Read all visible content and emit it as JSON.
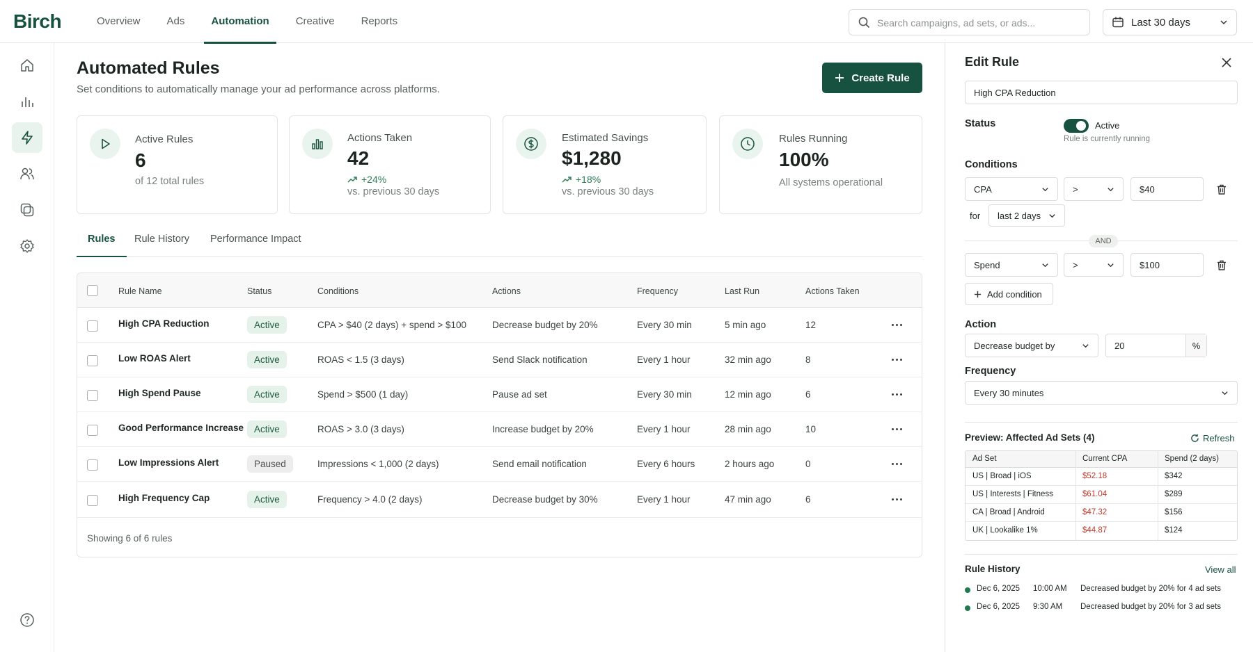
{
  "app": {
    "logo": "Birch"
  },
  "nav": [
    {
      "label": "Overview"
    },
    {
      "label": "Ads"
    },
    {
      "label": "Automation"
    },
    {
      "label": "Creative"
    },
    {
      "label": "Reports"
    }
  ],
  "search": {
    "placeholder": "Search campaigns, ad sets, or ads..."
  },
  "date_range": {
    "label": "Last 30 days"
  },
  "sidebar": {
    "icons": [
      "home-icon",
      "chart-icon",
      "bolt-icon",
      "users-icon",
      "layers-icon",
      "gear-icon",
      "help-icon"
    ]
  },
  "page": {
    "title": "Automated Rules",
    "subtitle": "Set conditions to automatically manage your ad performance across platforms.",
    "create_label": "Create Rule"
  },
  "kpis": [
    {
      "label": "Active Rules",
      "value": "6",
      "delta": "",
      "sub": "of 12 total rules"
    },
    {
      "label": "Actions Taken",
      "value": "42",
      "delta": "+24%",
      "sub": "vs. previous 30 days"
    },
    {
      "label": "Estimated Savings",
      "value": "$1,280",
      "delta": "+18%",
      "sub": "vs. previous 30 days"
    },
    {
      "label": "Rules Running",
      "value": "100%",
      "delta": "",
      "sub": "All systems operational"
    }
  ],
  "tabs": [
    {
      "label": "Rules"
    },
    {
      "label": "Rule History"
    },
    {
      "label": "Performance Impact"
    }
  ],
  "table": {
    "headers": [
      "Rule Name",
      "Status",
      "Conditions",
      "Actions",
      "Frequency",
      "Last Run",
      "Actions Taken"
    ],
    "rows": [
      {
        "name": "High CPA Reduction",
        "status": "Active",
        "conditions": "CPA > $40 (2 days) + spend > $100",
        "action": "Decrease budget by 20%",
        "frequency": "Every 30 min",
        "last_run": "5 min ago",
        "taken": "12"
      },
      {
        "name": "Low ROAS Alert",
        "status": "Active",
        "conditions": "ROAS < 1.5 (3 days)",
        "action": "Send Slack notification",
        "frequency": "Every 1 hour",
        "last_run": "32 min ago",
        "taken": "8"
      },
      {
        "name": "High Spend Pause",
        "status": "Active",
        "conditions": "Spend > $500 (1 day)",
        "action": "Pause ad set",
        "frequency": "Every 30 min",
        "last_run": "12 min ago",
        "taken": "6"
      },
      {
        "name": "Good Performance Increase",
        "status": "Active",
        "conditions": "ROAS > 3.0 (3 days)",
        "action": "Increase budget by 20%",
        "frequency": "Every 1 hour",
        "last_run": "28 min ago",
        "taken": "10"
      },
      {
        "name": "Low Impressions Alert",
        "status": "Paused",
        "conditions": "Impressions < 1,000 (2 days)",
        "action": "Send email notification",
        "frequency": "Every 6 hours",
        "last_run": "2 hours ago",
        "taken": "0"
      },
      {
        "name": "High Frequency Cap",
        "status": "Active",
        "conditions": "Frequency > 4.0 (2 days)",
        "action": "Decrease budget by 30%",
        "frequency": "Every 1 hour",
        "last_run": "47 min ago",
        "taken": "6"
      }
    ],
    "footer": "Showing 6 of 6 rules"
  },
  "panel": {
    "title": "Edit Rule",
    "rule_name": "High CPA Reduction",
    "status_label": "Status",
    "status_value": "Active",
    "status_hint": "Rule is currently running",
    "conditions_label": "Conditions",
    "condition1": {
      "metric": "CPA",
      "operator": ">",
      "value": "$40",
      "for_label": "for",
      "period": "last 2 days"
    },
    "and_label": "AND",
    "condition2": {
      "metric": "Spend",
      "operator": ">",
      "value": "$100"
    },
    "add_condition": "Add condition",
    "action_label": "Action",
    "action_value": "Decrease budget by",
    "action_amount": "20",
    "action_unit": "%",
    "frequency_label": "Frequency",
    "frequency_value": "Every 30 minutes",
    "preview_title": "Preview: Affected Ad Sets (4)",
    "refresh": "Refresh",
    "preview_headers": [
      "Ad Set",
      "Current CPA",
      "Spend (2 days)"
    ],
    "preview_rows": [
      {
        "ad_set": "US | Broad | iOS",
        "cpa": "$52.18",
        "spend": "$342"
      },
      {
        "ad_set": "US | Interests | Fitness",
        "cpa": "$61.04",
        "spend": "$289"
      },
      {
        "ad_set": "CA | Broad | Android",
        "cpa": "$47.32",
        "spend": "$156"
      },
      {
        "ad_set": "UK | Lookalike 1%",
        "cpa": "$44.87",
        "spend": "$124"
      }
    ],
    "history_title": "Rule History",
    "view_all": "View all",
    "history": [
      {
        "date": "Dec 6, 2025",
        "time": "10:00 AM",
        "text": "Decreased budget by 20% for 4 ad sets"
      },
      {
        "date": "Dec 6, 2025",
        "time": "9:30 AM",
        "text": "Decreased budget by 20% for 3 ad sets"
      }
    ]
  },
  "colors": {
    "brand": "#17513f",
    "accent_bg": "#e7f3ec",
    "positive": "#2e7d55",
    "negative": "#c0392b"
  }
}
